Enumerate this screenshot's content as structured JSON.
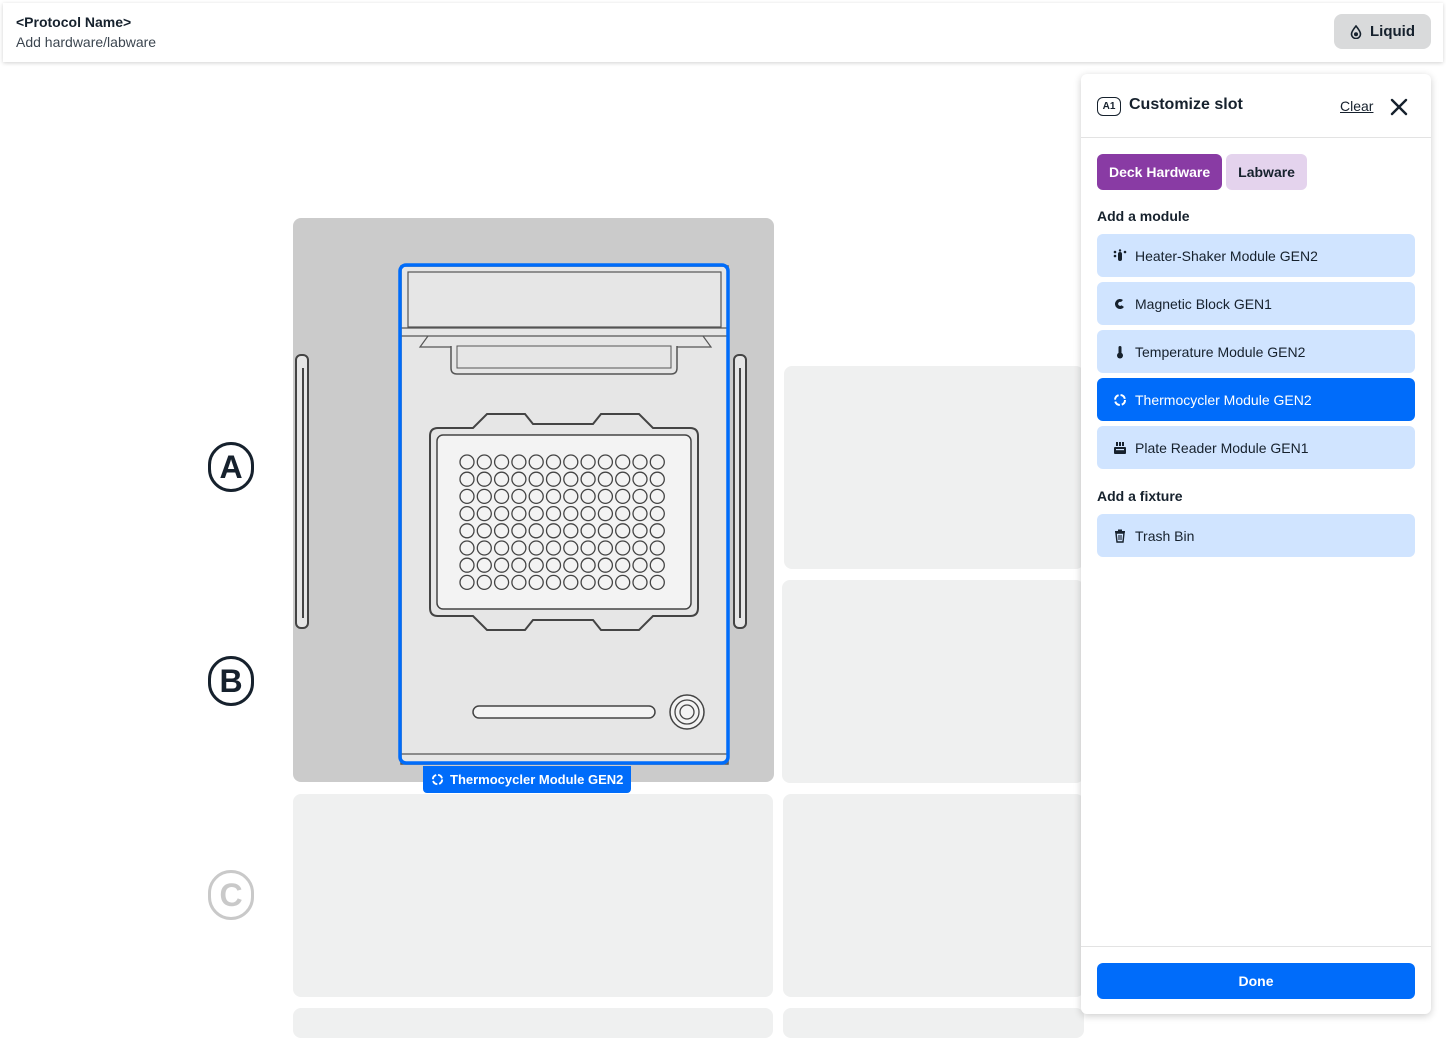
{
  "header": {
    "protocol_name": "<Protocol Name>",
    "subtitle": "Add hardware/labware",
    "liquid_button": "Liquid"
  },
  "deck": {
    "row_labels": [
      "A",
      "B",
      "C"
    ],
    "placed_module_label": "Thermocycler Module GEN2"
  },
  "panel": {
    "slot_id": "A1",
    "title": "Customize slot",
    "clear_label": "Clear",
    "tabs": [
      {
        "label": "Deck Hardware",
        "selected": true
      },
      {
        "label": "Labware",
        "selected": false
      }
    ],
    "module_section_title": "Add a module",
    "modules": [
      {
        "label": "Heater-Shaker Module GEN2",
        "icon": "heater-shaker-icon",
        "selected": false
      },
      {
        "label": "Magnetic Block GEN1",
        "icon": "magnet-icon",
        "selected": false
      },
      {
        "label": "Temperature Module GEN2",
        "icon": "thermometer-icon",
        "selected": false
      },
      {
        "label": "Thermocycler Module GEN2",
        "icon": "thermocycler-icon",
        "selected": true
      },
      {
        "label": "Plate Reader Module GEN1",
        "icon": "plate-reader-icon",
        "selected": false
      }
    ],
    "fixture_section_title": "Add a fixture",
    "fixtures": [
      {
        "label": "Trash Bin",
        "icon": "trash-icon",
        "selected": false
      }
    ],
    "done_label": "Done"
  },
  "colors": {
    "accent_blue": "#006cfa",
    "tab_purple": "#893ba4",
    "tab_purple_light": "#e4d3ed",
    "option_light_blue": "#d0e4ff",
    "slot_gray": "#eff0f0",
    "active_slot_gray": "#cbcbcb"
  }
}
